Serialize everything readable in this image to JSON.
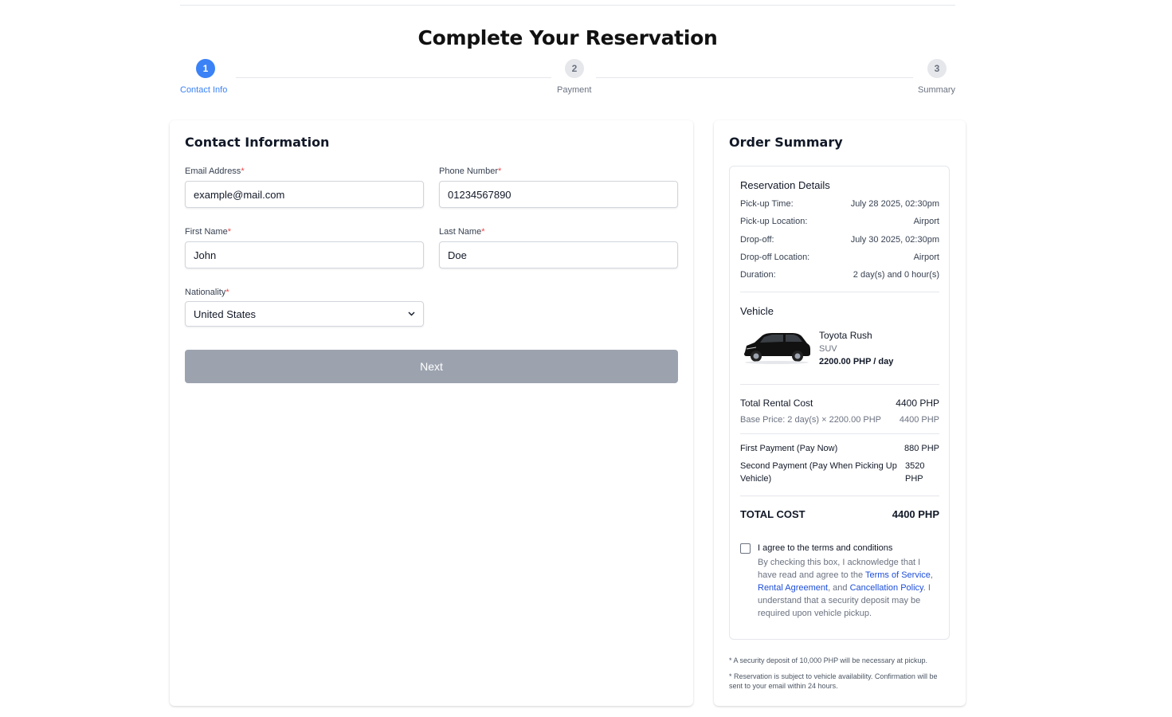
{
  "page": {
    "title": "Complete Your Reservation"
  },
  "stepper": {
    "steps": [
      {
        "number": "1",
        "label": "Contact Info"
      },
      {
        "number": "2",
        "label": "Payment"
      },
      {
        "number": "3",
        "label": "Summary"
      }
    ],
    "active_step": 1
  },
  "contact": {
    "title": "Contact Information",
    "required_mark": "*",
    "email": {
      "label": "Email Address",
      "value": "example@mail.com"
    },
    "phone": {
      "label": "Phone Number",
      "value": "01234567890"
    },
    "first_name": {
      "label": "First Name",
      "value": "John"
    },
    "last_name": {
      "label": "Last Name",
      "value": "Doe"
    },
    "nationality": {
      "label": "Nationality",
      "value": "United States"
    },
    "next_label": "Next"
  },
  "summary": {
    "title": "Order Summary",
    "reservation_heading": "Reservation Details",
    "details": [
      {
        "label": "Pick-up Time:",
        "value": "July 28 2025, 02:30pm"
      },
      {
        "label": "Pick-up Location:",
        "value": "Airport"
      },
      {
        "label": "Drop-off:",
        "value": "July 30 2025, 02:30pm"
      },
      {
        "label": "Drop-off Location:",
        "value": "Airport"
      },
      {
        "label": "Duration:",
        "value": "2 day(s) and 0 hour(s)"
      }
    ],
    "vehicle_heading": "Vehicle",
    "vehicle": {
      "name": "Toyota Rush",
      "type": "SUV",
      "price": "2200.00 PHP / day"
    },
    "total_rental_label": "Total Rental Cost",
    "total_rental_value": "4400 PHP",
    "base_price_label": "Base Price: 2 day(s) × 2200.00 PHP",
    "base_price_value": "4400 PHP",
    "first_payment_label": "First Payment (Pay Now)",
    "first_payment_value": "880 PHP",
    "second_payment_label_1": "Second Payment (Pay When Picking Up",
    "second_payment_label_2": "Vehicle)",
    "second_payment_value_1": "3520",
    "second_payment_value_2": "PHP",
    "total_cost_label": "TOTAL COST",
    "total_cost_value": "4400 PHP",
    "terms": {
      "agree_label": "I agree to the terms and conditions",
      "desc_1": "By checking this box, I acknowledge that I have read and agree to the ",
      "link_tos": "Terms of Service",
      "sep_1": ", ",
      "link_rental": "Rental Agreement",
      "sep_2": ", and ",
      "link_cancel": "Cancellation Policy",
      "desc_2": ". I understand that a security deposit may be required upon vehicle pickup."
    },
    "footnote_1": "* A security deposit of 10,000 PHP will be necessary at pickup.",
    "footnote_2": "* Reservation is subject to vehicle availability. Confirmation will be sent to your email within 24 hours."
  },
  "colors": {
    "accent": "#3b82f6",
    "required": "#ef4444",
    "button_disabled": "#9ca3af",
    "link": "#1d4ed8"
  }
}
